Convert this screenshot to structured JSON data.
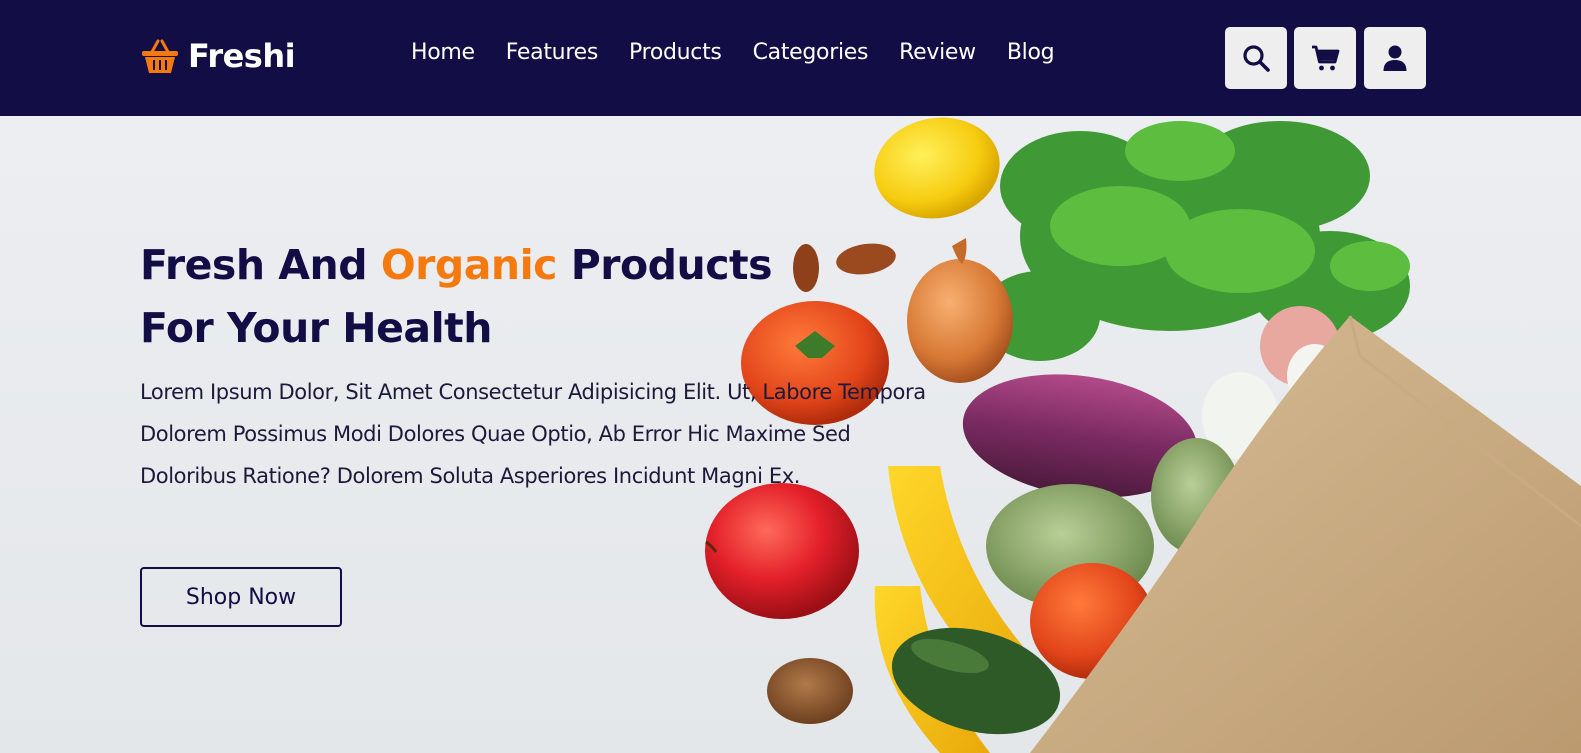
{
  "header": {
    "brand": "Freshi",
    "nav": [
      "Home",
      "Features",
      "Products",
      "Categories",
      "Review",
      "Blog"
    ],
    "icons": [
      "search-icon",
      "cart-icon",
      "user-icon"
    ]
  },
  "hero": {
    "title_part1": "Fresh And ",
    "title_accent": "Organic",
    "title_part2": " Products For Your Health",
    "description": "Lorem Ipsum Dolor, Sit Amet Consectetur Adipisicing Elit. Ut, Labore Tempora Dolorem Possimus Modi Dolores Quae Optio, Ab Error Hic Maxime Sed Doloribus Ratione? Dolorem Soluta Asperiores Incidunt Magni Ex.",
    "cta_label": "Shop Now"
  },
  "colors": {
    "header_bg": "#120d45",
    "accent": "#f47a10",
    "hero_bg": "#e9ebee"
  }
}
